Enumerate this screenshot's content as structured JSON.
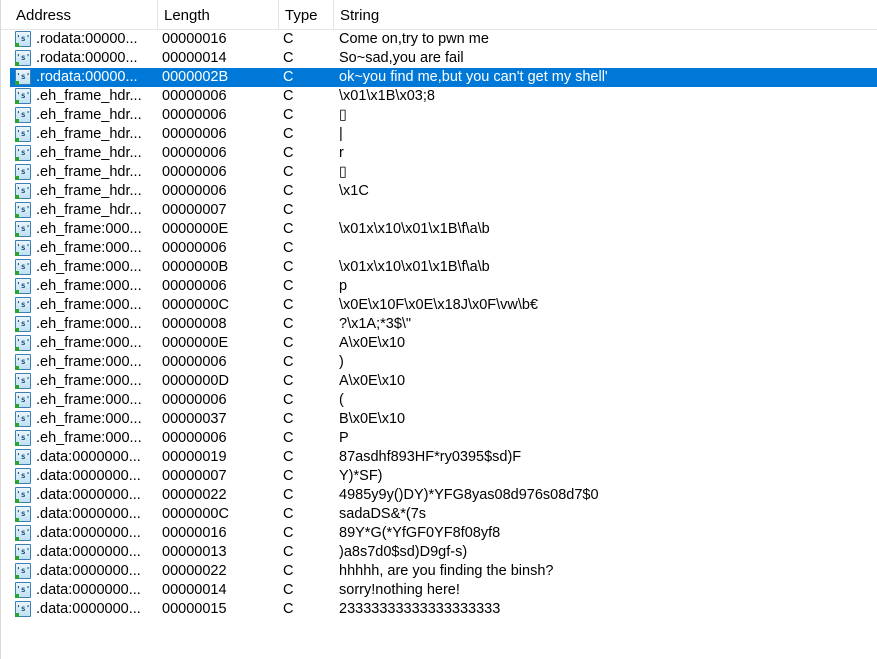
{
  "columns": {
    "address": "Address",
    "length": "Length",
    "type": "Type",
    "string": "String"
  },
  "icon": "string-literal-icon",
  "selected_index": 2,
  "colors": {
    "selection": "#0078d7",
    "grid_line": "#e5e5e5"
  },
  "rows": [
    {
      "address": ".rodata:00000...",
      "length": "00000016",
      "type": "C",
      "string": "Come on,try to pwn me"
    },
    {
      "address": ".rodata:00000...",
      "length": "00000014",
      "type": "C",
      "string": "So~sad,you are fail"
    },
    {
      "address": ".rodata:00000...",
      "length": "0000002B",
      "type": "C",
      "string": "ok~you find me,but you can't get my shell'"
    },
    {
      "address": ".eh_frame_hdr...",
      "length": "00000006",
      "type": "C",
      "string": "\\x01\\x1B\\x03;8"
    },
    {
      "address": ".eh_frame_hdr...",
      "length": "00000006",
      "type": "C",
      "string": "▯"
    },
    {
      "address": ".eh_frame_hdr...",
      "length": "00000006",
      "type": "C",
      "string": "|"
    },
    {
      "address": ".eh_frame_hdr...",
      "length": "00000006",
      "type": "C",
      "string": "r"
    },
    {
      "address": ".eh_frame_hdr...",
      "length": "00000006",
      "type": "C",
      "string": "▯"
    },
    {
      "address": ".eh_frame_hdr...",
      "length": "00000006",
      "type": "C",
      "string": "\\x1C"
    },
    {
      "address": ".eh_frame_hdr...",
      "length": "00000007",
      "type": "C",
      "string": ""
    },
    {
      "address": ".eh_frame:000...",
      "length": "0000000E",
      "type": "C",
      "string": "\\x01x\\x10\\x01\\x1B\\f\\a\\b"
    },
    {
      "address": ".eh_frame:000...",
      "length": "00000006",
      "type": "C",
      "string": ""
    },
    {
      "address": ".eh_frame:000...",
      "length": "0000000B",
      "type": "C",
      "string": "\\x01x\\x10\\x01\\x1B\\f\\a\\b"
    },
    {
      "address": ".eh_frame:000...",
      "length": "00000006",
      "type": "C",
      "string": "p"
    },
    {
      "address": ".eh_frame:000...",
      "length": "0000000C",
      "type": "C",
      "string": "\\x0E\\x10F\\x0E\\x18J\\x0F\\vw\\b€"
    },
    {
      "address": ".eh_frame:000...",
      "length": "00000008",
      "type": "C",
      "string": "?\\x1A;*3$\\\""
    },
    {
      "address": ".eh_frame:000...",
      "length": "0000000E",
      "type": "C",
      "string": "A\\x0E\\x10"
    },
    {
      "address": ".eh_frame:000...",
      "length": "00000006",
      "type": "C",
      "string": ")"
    },
    {
      "address": ".eh_frame:000...",
      "length": "0000000D",
      "type": "C",
      "string": "A\\x0E\\x10"
    },
    {
      "address": ".eh_frame:000...",
      "length": "00000006",
      "type": "C",
      "string": "("
    },
    {
      "address": ".eh_frame:000...",
      "length": "00000037",
      "type": "C",
      "string": "B\\x0E\\x10"
    },
    {
      "address": ".eh_frame:000...",
      "length": "00000006",
      "type": "C",
      "string": "P"
    },
    {
      "address": ".data:0000000...",
      "length": "00000019",
      "type": "C",
      "string": "87asdhf893HF*ry0395$sd)F"
    },
    {
      "address": ".data:0000000...",
      "length": "00000007",
      "type": "C",
      "string": "Y)*SF)"
    },
    {
      "address": ".data:0000000...",
      "length": "00000022",
      "type": "C",
      "string": "4985y9y()DY)*YFG8yas08d976s08d7$0"
    },
    {
      "address": ".data:0000000...",
      "length": "0000000C",
      "type": "C",
      "string": "sadaDS&*(7s"
    },
    {
      "address": ".data:0000000...",
      "length": "00000016",
      "type": "C",
      "string": "89Y*G(*YfGF0YF8f08yf8"
    },
    {
      "address": ".data:0000000...",
      "length": "00000013",
      "type": "C",
      "string": ")a8s7d0$sd)D9gf-s)"
    },
    {
      "address": ".data:0000000...",
      "length": "00000022",
      "type": "C",
      "string": "hhhhh, are you finding the binsh?"
    },
    {
      "address": ".data:0000000...",
      "length": "00000014",
      "type": "C",
      "string": "sorry!nothing here!"
    },
    {
      "address": ".data:0000000...",
      "length": "00000015",
      "type": "C",
      "string": "23333333333333333333"
    }
  ]
}
